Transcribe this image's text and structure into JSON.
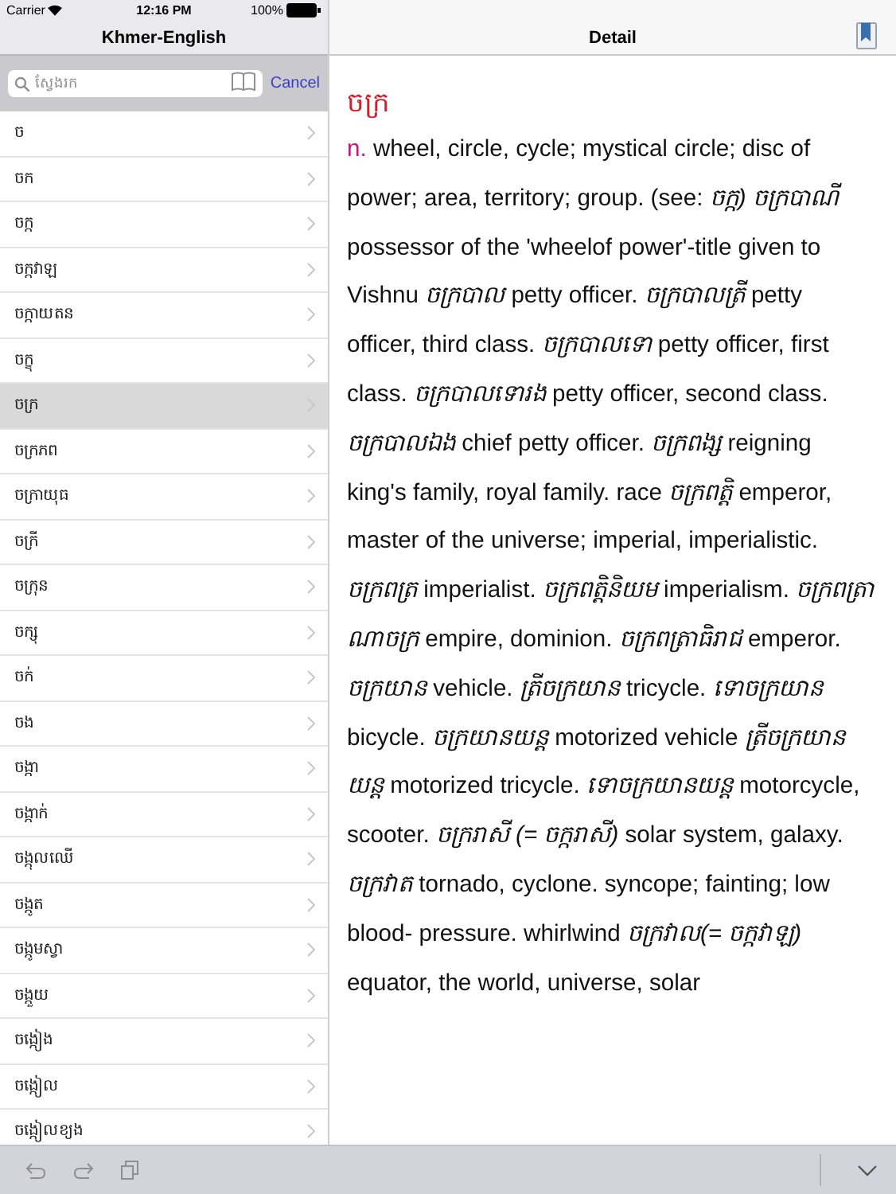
{
  "status_bar": {
    "carrier": "Carrier",
    "time": "12:16 PM",
    "battery": "100%"
  },
  "sidebar": {
    "title": "Khmer-English",
    "search": {
      "placeholder": "ស្វែងរក"
    },
    "cancel": "Cancel",
    "items": [
      {
        "label": "ច",
        "selected": false
      },
      {
        "label": "ចក",
        "selected": false
      },
      {
        "label": "ចក្ក",
        "selected": false
      },
      {
        "label": "ចក្កវាឡ",
        "selected": false
      },
      {
        "label": "ចក្កាយតន",
        "selected": false
      },
      {
        "label": "ចក្ខុ",
        "selected": false
      },
      {
        "label": "ចក្រ",
        "selected": true
      },
      {
        "label": "ចក្រភព",
        "selected": false
      },
      {
        "label": "ចក្រាយុធ",
        "selected": false
      },
      {
        "label": "ចក្រី",
        "selected": false
      },
      {
        "label": "ចក្រុន",
        "selected": false
      },
      {
        "label": "ចក្សុ",
        "selected": false
      },
      {
        "label": "ចក់",
        "selected": false
      },
      {
        "label": "ចង",
        "selected": false
      },
      {
        "label": "ចង្កា",
        "selected": false
      },
      {
        "label": "ចង្កាក់",
        "selected": false
      },
      {
        "label": "ចង្កុលឈើ",
        "selected": false
      },
      {
        "label": "ចង្កូត",
        "selected": false
      },
      {
        "label": "ចង្កូមស្វា",
        "selected": false
      },
      {
        "label": "ចង្កួយ",
        "selected": false
      },
      {
        "label": "ចង្កៀង",
        "selected": false
      },
      {
        "label": "ចង្កៀល",
        "selected": false
      },
      {
        "label": "ចង្កៀលខ្យង",
        "selected": false
      }
    ]
  },
  "detail": {
    "title": "Detail",
    "headword": "ចក្រ",
    "part_of_speech": "n.",
    "definition": "wheel, circle, cycle; mystical circle; disc of power; area, territory; group. (see: *ចក្ក)* *ចក្របាណី* possessor of the 'wheelof power'-title given to Vishnu *ចក្របាល* petty officer. *ចក្របាលត្រី* petty officer, third class. *ចក្របាលទោ* petty officer, first class. *ចក្របាលទោរង* petty officer, second class. *ចក្របាលឯង* chief petty officer. *ចក្រពង្ស* reigning king's family, royal family. race *ចក្រពត្តិ* emperor, master of the universe; imperial, imperialistic. *ចក្រពត្រ* imperialist. *ចក្រពត្តិនិយម* imperialism. *ចក្រពត្រាណាចក្រ* empire, dominion. *ចក្រពត្រាធិរាជ* emperor. *ចក្រយាន* vehicle. *ត្រីចក្រយាន* tricycle. *ទោចក្រយាន* bicycle. *ចក្រយានយន្ត* motorized vehicle *ត្រីចក្រយានយន្ត* motorized tricycle. *ទោចក្រយានយន្ត* motorcycle, scooter. *ចក្ររាសី (= ចក្ករាសី)* solar system, galaxy. *ចក្រវាត* tornado, cyclone. syncope; fainting; low blood- pressure. whirlwind *ចក្រវាល(= ចក្កវាឡ)* equator, the world, universe, solar"
  }
}
